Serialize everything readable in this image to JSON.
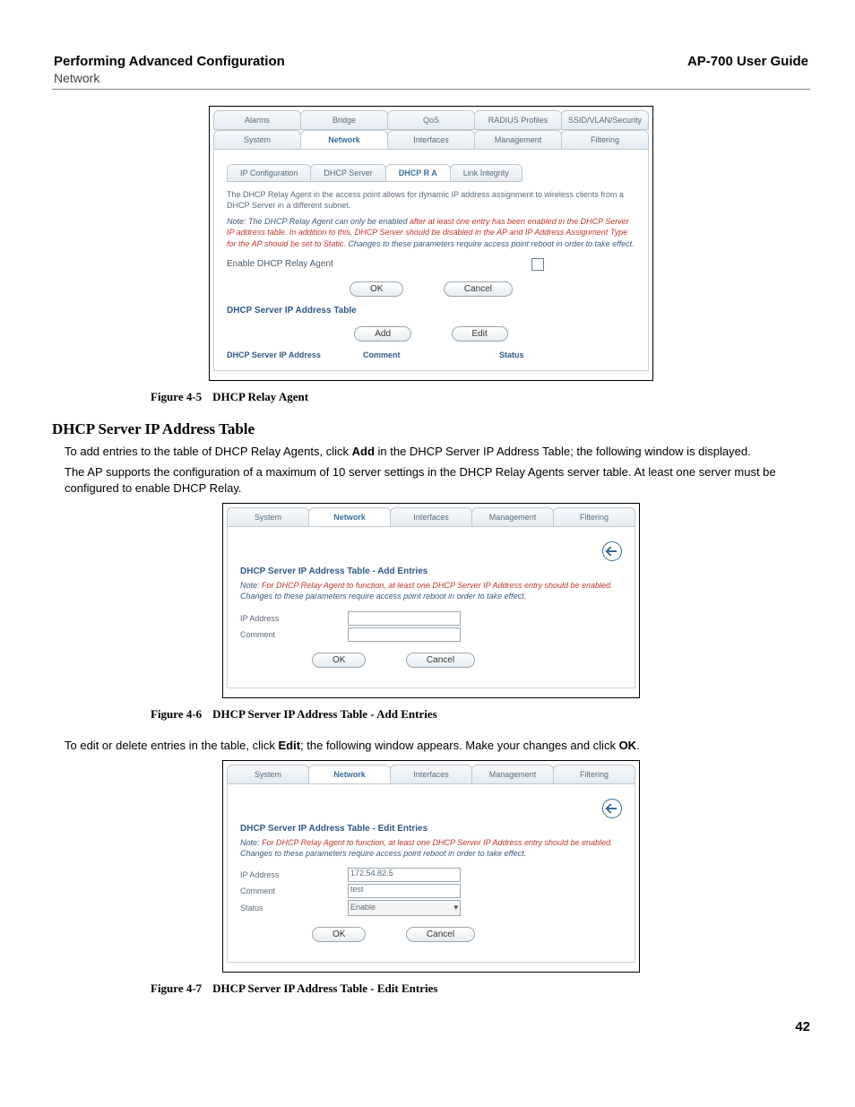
{
  "header": {
    "title": "Performing Advanced Configuration",
    "guide": "AP-700 User Guide",
    "sub": "Network"
  },
  "fig1": {
    "tabs1": [
      "Alarms",
      "Bridge",
      "QoS",
      "RADIUS Profiles",
      "SSID/VLAN/Security"
    ],
    "tabs2": [
      "System",
      "Network",
      "Interfaces",
      "Management",
      "Filtering"
    ],
    "tabs2_active": 1,
    "subtabs": [
      "IP Configuration",
      "DHCP Server",
      "DHCP R A",
      "Link Integrity"
    ],
    "subtabs_active": 2,
    "desc": "The DHCP Relay Agent in the access point allows for dynamic IP address assignment to wireless clients from a DHCP Server in a different subnet.",
    "note_lead": "Note: The DHCP Relay Agent can only be enabled ",
    "note_red": "after at least one entry has been enabled in the DHCP Server IP address table. In addition to this, DHCP Server should be disabled in the AP and IP Address Assignment Type for the AP should be set to Static.",
    "note_tail": " Changes to these parameters require access point reboot in order to take effect.",
    "enable_label": "Enable DHCP Relay Agent",
    "ok": "OK",
    "cancel": "Cancel",
    "section": "DHCP Server IP Address Table",
    "add": "Add",
    "edit": "Edit",
    "tbl": [
      "DHCP Server IP Address",
      "Comment",
      "Status"
    ],
    "cap_num": "Figure 4-5",
    "cap_ttl": "DHCP Relay Agent"
  },
  "section2": {
    "heading": "DHCP Server IP Address Table",
    "p1a": "To add entries to the table of DHCP Relay Agents, click ",
    "p1b": "Add",
    "p1c": " in the DHCP Server IP Address Table; the following window is displayed.",
    "p2": "The AP supports the configuration of a maximum of 10 server settings in the DHCP Relay Agents server table. At least one server must be configured to enable DHCP Relay."
  },
  "fig2": {
    "tabs": [
      "System",
      "Network",
      "Interfaces",
      "Management",
      "Filtering"
    ],
    "tabs_active": 1,
    "hdr": "DHCP Server IP Address Table - Add Entries",
    "note_lead": "Note: ",
    "note_red": "For DHCP Relay Agent to function, at least one DHCP Server IP Address entry should be enabled.",
    "note_tail": " Changes to these parameters require access point reboot in order to take effect.",
    "ip_label": "IP Address",
    "comment_label": "Comment",
    "ip_value": "",
    "comment_value": "",
    "ok": "OK",
    "cancel": "Cancel",
    "cap_num": "Figure 4-6",
    "cap_ttl": "DHCP Server IP Address Table - Add Entries"
  },
  "mid": {
    "p1a": "To edit or delete entries in the table, click ",
    "p1b": "Edit",
    "p1c": "; the following window appears. Make your changes and click ",
    "p1d": "OK",
    "p1e": "."
  },
  "fig3": {
    "tabs": [
      "System",
      "Network",
      "Interfaces",
      "Management",
      "Filtering"
    ],
    "tabs_active": 1,
    "hdr": "DHCP Server IP Address Table - Edit Entries",
    "note_lead": "Note: ",
    "note_red": "For DHCP Relay Agent to function, at least one DHCP Server IP Address entry should be enabled.",
    "note_tail": " Changes to these parameters require access point reboot in order to take effect.",
    "ip_label": "IP Address",
    "comment_label": "Comment",
    "status_label": "Status",
    "ip_value": "172.54.82.5",
    "comment_value": "test",
    "status_value": "Enable",
    "ok": "OK",
    "cancel": "Cancel",
    "cap_num": "Figure 4-7",
    "cap_ttl": "DHCP Server IP Address Table - Edit Entries"
  },
  "page_number": "42"
}
